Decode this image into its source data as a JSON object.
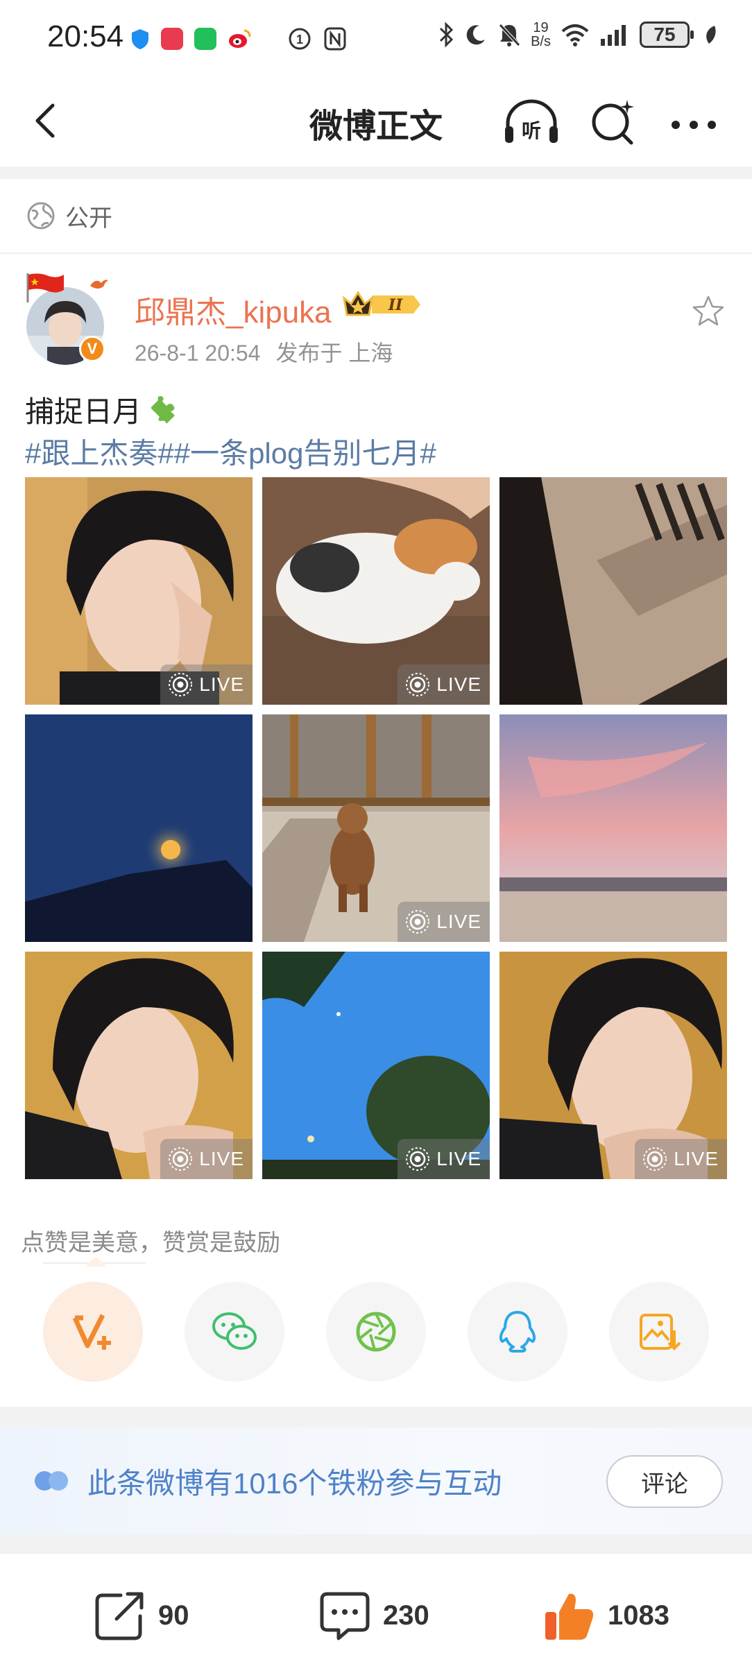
{
  "status_bar": {
    "time": "20:54",
    "net_speed_value": "19",
    "net_speed_unit": "B/s",
    "battery": "75"
  },
  "nav": {
    "title": "微博正文",
    "listen_label": "听"
  },
  "visibility": {
    "label": "公开"
  },
  "post": {
    "author": "邱鼎杰_kipuka",
    "vip_level": "II",
    "time": "26-8-1 20:54",
    "location": "发布于 上海",
    "text": "捕捉日月",
    "hashtags": "#跟上杰奏##一条plog告别七月#",
    "photos": [
      {
        "subject": "selfie",
        "live": true
      },
      {
        "subject": "cat",
        "live": true
      },
      {
        "subject": "shadow-floor",
        "live": false
      },
      {
        "subject": "moon-night",
        "live": false
      },
      {
        "subject": "dog-window",
        "live": true
      },
      {
        "subject": "sunset-sky",
        "live": false
      },
      {
        "subject": "selfie",
        "live": true
      },
      {
        "subject": "tree-sky",
        "live": true
      },
      {
        "subject": "selfie",
        "live": true
      }
    ],
    "live_label": "LIVE"
  },
  "reward": {
    "hint": "点赞是美意，赞赏是鼓励",
    "options": [
      "v-plus-icon",
      "wechat-icon",
      "moments-icon",
      "qq-icon",
      "save-image-icon"
    ]
  },
  "fans": {
    "text": "此条微博有1016个铁粉参与互动",
    "button": "评论"
  },
  "actions": {
    "reposts": "90",
    "comments": "230",
    "likes": "1083"
  },
  "colors": {
    "author": "#eb7350",
    "hashtag": "#5b7ca5",
    "fans_text": "#4f82c8",
    "like": "#f0602a"
  }
}
